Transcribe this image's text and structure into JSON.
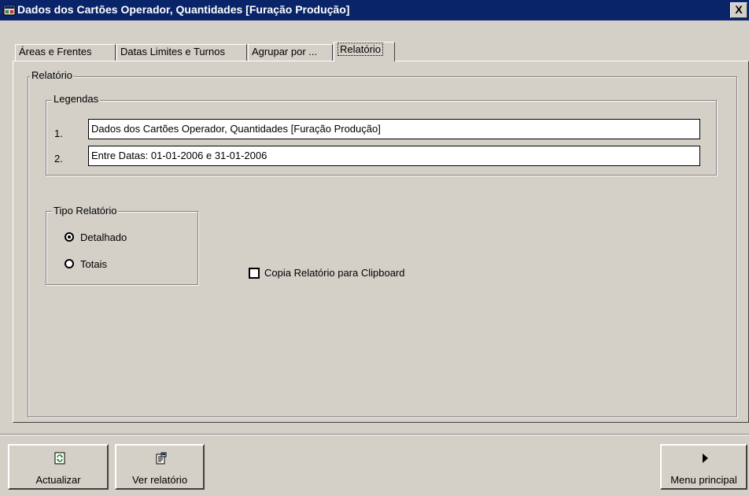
{
  "window": {
    "title": "Dados dos Cartões Operador, Quantidades [Furação Produção]",
    "close_label": "X"
  },
  "tabs": [
    {
      "label": "Áreas e Frentes"
    },
    {
      "label": "Datas Limites e Turnos"
    },
    {
      "label": "Agrupar por ..."
    },
    {
      "label": "Relatório"
    }
  ],
  "report": {
    "group_label": "Relatório",
    "legends": {
      "group_label": "Legendas",
      "lines": [
        {
          "num": "1.",
          "value": "Dados dos Cartões Operador, Quantidades [Furação Produção]"
        },
        {
          "num": "2.",
          "value": "Entre Datas: 01-01-2006 e 31-01-2006"
        }
      ]
    },
    "type": {
      "group_label": "Tipo Relatório",
      "options": [
        {
          "label": "Detalhado",
          "selected": true
        },
        {
          "label": "Totais",
          "selected": false
        }
      ]
    },
    "clipboard": {
      "label": "Copia Relatório para Clipboard",
      "checked": false
    }
  },
  "buttons": {
    "update": "Actualizar",
    "view": "Ver relatório",
    "menu": "Menu principal"
  },
  "icons": {
    "window": "app-window-icon",
    "update": "refresh-icon",
    "view": "report-icon",
    "menu": "play-arrow-icon"
  },
  "colors": {
    "titlebar": "#0a246a",
    "face": "#d4d0c8"
  }
}
